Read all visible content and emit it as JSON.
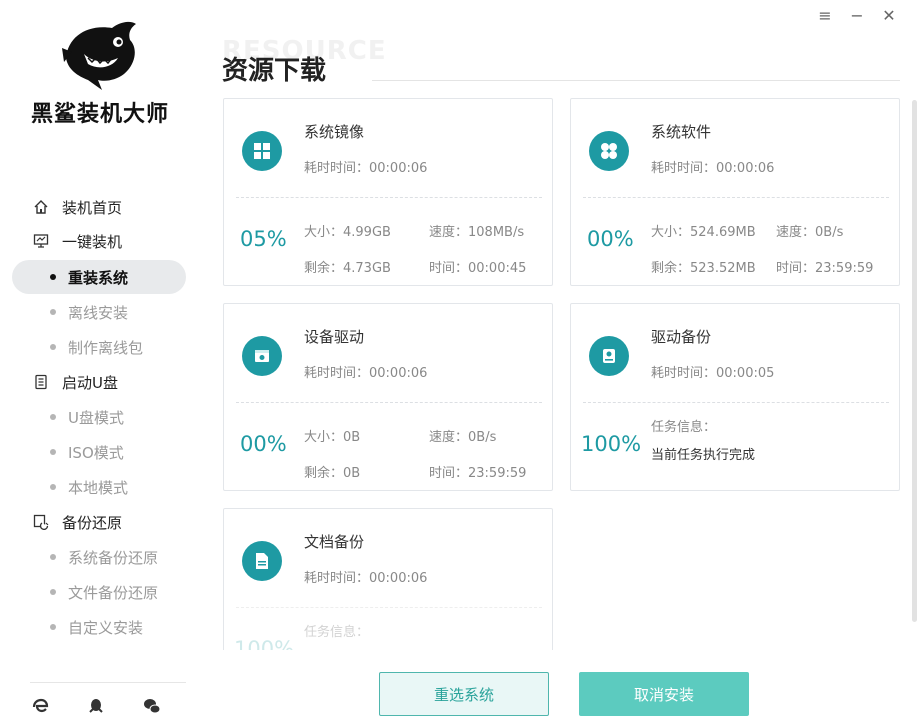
{
  "app": {
    "brand_name": "黑鲨装机大师",
    "accent_color": "#1e9aa3"
  },
  "window_controls": {
    "menu": "≡",
    "minimize": "−",
    "close": "✕"
  },
  "sidebar": {
    "items": [
      {
        "type": "main",
        "label": "装机首页",
        "icon": "home-icon"
      },
      {
        "type": "main",
        "label": "一键装机",
        "icon": "monitor-icon"
      },
      {
        "type": "sub",
        "label": "重装系统",
        "active": true
      },
      {
        "type": "sub",
        "label": "离线安装"
      },
      {
        "type": "sub",
        "label": "制作离线包"
      },
      {
        "type": "main",
        "label": "启动U盘",
        "icon": "usb-drive-icon"
      },
      {
        "type": "sub",
        "label": "U盘模式"
      },
      {
        "type": "sub",
        "label": "ISO模式"
      },
      {
        "type": "sub",
        "label": "本地模式"
      },
      {
        "type": "main",
        "label": "备份还原",
        "icon": "backup-icon"
      },
      {
        "type": "sub",
        "label": "系统备份还原"
      },
      {
        "type": "sub",
        "label": "文件备份还原"
      },
      {
        "type": "sub",
        "label": "自定义安装"
      }
    ]
  },
  "page": {
    "watermark": "RESOURCE",
    "title": "资源下载"
  },
  "cards": [
    {
      "name": "系统镜像",
      "icon": "windows-icon",
      "elapsed": "耗时时间：00:00:06",
      "percent": "05%",
      "size": "大小：4.99GB",
      "speed": "速度：108MB/s",
      "remaining": "剩余：4.73GB",
      "time": "时间：00:00:45"
    },
    {
      "name": "系统软件",
      "icon": "apps-icon",
      "elapsed": "耗时时间：00:00:06",
      "percent": "00%",
      "size": "大小：524.69MB",
      "speed": "速度：0B/s",
      "remaining": "剩余：523.52MB",
      "time": "时间：23:59:59"
    },
    {
      "name": "设备驱动",
      "icon": "driver-icon",
      "elapsed": "耗时时间：00:00:06",
      "percent": "00%",
      "size": "大小：0B",
      "speed": "速度：0B/s",
      "remaining": "剩余：0B",
      "time": "时间：23:59:59"
    },
    {
      "name": "驱动备份",
      "icon": "disk-backup-icon",
      "elapsed": "耗时时间：00:00:05",
      "percent": "100%",
      "task_label": "任务信息：",
      "task_value": "当前任务执行完成"
    },
    {
      "name": "文档备份",
      "icon": "document-icon",
      "elapsed": "耗时时间：00:00:06",
      "percent": "100%",
      "task_label": "任务信息："
    }
  ],
  "buttons": {
    "reselect": "重选系统",
    "cancel": "取消安装"
  }
}
